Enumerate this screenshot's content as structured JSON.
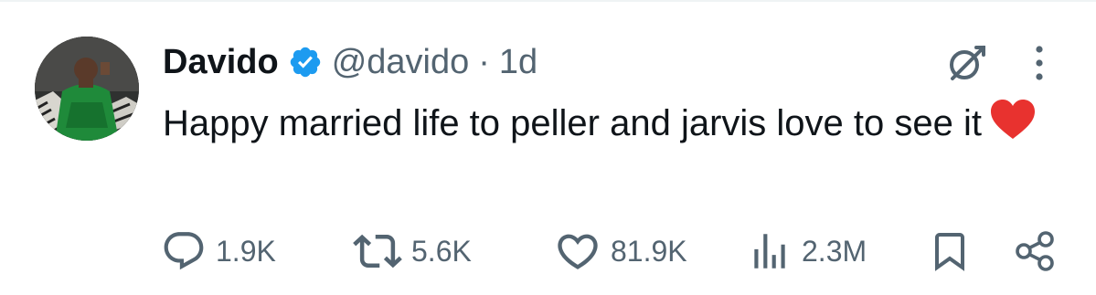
{
  "tweet": {
    "display_name": "Davido",
    "handle": "@davido",
    "separator": "·",
    "time": "1d",
    "text": "Happy married life to peller and jarvis love to see it",
    "emoji": "❤️",
    "avatar_icon": "avatar",
    "verified_icon": "verified-badge-icon",
    "accent_color": "#1d9bf0"
  },
  "actions": {
    "reply_count": "1.9K",
    "retweet_count": "5.6K",
    "like_count": "81.9K",
    "views_count": "2.3M"
  }
}
